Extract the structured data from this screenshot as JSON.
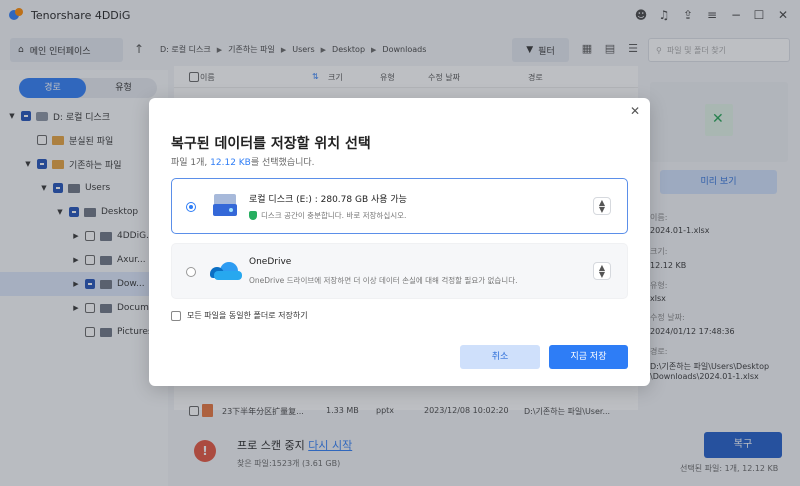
{
  "app": {
    "title": "Tenorshare 4DDiG"
  },
  "toolbar": {
    "home_label": "메인 인터페이스",
    "breadcrumb": [
      "D: 로컬 디스크",
      "기존하는 파일",
      "Users",
      "Desktop",
      "Downloads"
    ],
    "filter_label": "필터",
    "search_placeholder": "파일 및 폴더 찾기"
  },
  "sidebar": {
    "tab_path": "경로",
    "tab_type": "유형",
    "tree": [
      {
        "label": "D: 로컬 디스크"
      },
      {
        "label": "분실된 파일"
      },
      {
        "label": "기존하는 파일"
      },
      {
        "label": "Users"
      },
      {
        "label": "Desktop"
      },
      {
        "label": "4DDiG..."
      },
      {
        "label": "Axur..."
      },
      {
        "label": "Dow..."
      },
      {
        "label": "Docum..."
      },
      {
        "label": "Pictures"
      }
    ]
  },
  "table": {
    "headers": {
      "name": "이름",
      "size": "크기",
      "type": "유형",
      "modified": "수정 날짜",
      "path": "경로"
    },
    "rows": [
      {
        "name": "23下半年分区扩量复...",
        "size": "1.33 MB",
        "type": "pptx",
        "modified": "2023/12/08 10:02:20",
        "path": "D:\\기존하는 파일\\User..."
      }
    ]
  },
  "preview": {
    "button_label": "미리 보기",
    "name_label": "이름:",
    "name_value": "2024.01-1.xlsx",
    "size_label": "크기:",
    "size_value": "12.12 KB",
    "type_label": "유형:",
    "type_value": "xlsx",
    "modified_label": "수정 날짜:",
    "modified_value": "2024/01/12 17:48:36",
    "path_label": "경로:",
    "path_value_1": "D:\\기존하는 파일\\Users\\Desktop",
    "path_value_2": "\\Downloads\\2024.01-1.xlsx"
  },
  "bottom": {
    "scan_status": "프로 스캔 중지",
    "restart_label": "다시 시작",
    "found_text": "찾은 파일:1523개 (3.61 GB)",
    "recover_label": "복구",
    "selected_text": "선택된 파일: 1개, 12.12 KB"
  },
  "dialog": {
    "title": "복구된 데이터를 저장할 위치 선택",
    "subtitle_prefix": "파일 ",
    "subtitle_count": "1개, ",
    "subtitle_size": "12.12 KB",
    "subtitle_suffix": "를 선택했습니다.",
    "options": [
      {
        "title": "로컬 디스크 (E:) : 280.78 GB 사용 가능",
        "note": "디스크 공간이 충분합니다. 바로 저장하십시오.",
        "selected": true
      },
      {
        "title": "OneDrive",
        "note": "OneDrive 드라이브에 저장하면 더 이상 데이터 손실에 대해 걱정할 필요가 없습니다.",
        "selected": false
      }
    ],
    "same_folder_label": "모든 파일을 동일한 폴더로 저장하기",
    "cancel_label": "취소",
    "save_label": "지금 저장"
  },
  "colors": {
    "accent": "#2e7df6",
    "recover_button": "#1e5cc8",
    "shield_green": "#27ae60"
  }
}
